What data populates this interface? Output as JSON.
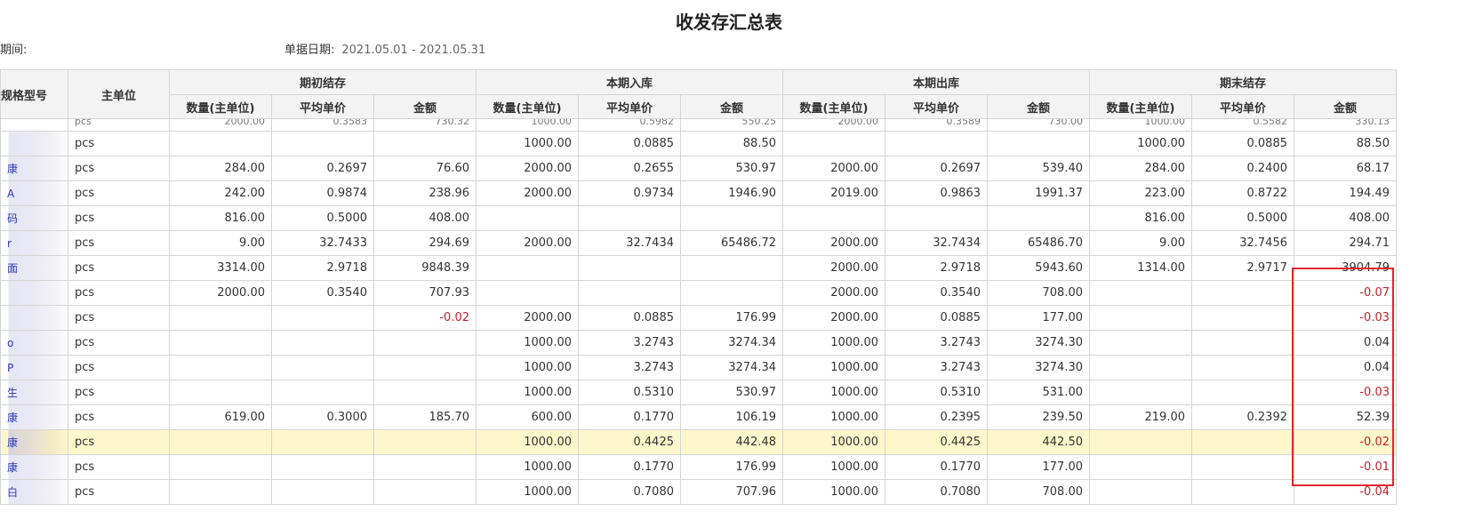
{
  "title": "收发存汇总表",
  "meta": {
    "period_label": "期间:",
    "date_label": "单据日期:",
    "date_value": "2021.05.01 - 2021.05.31"
  },
  "headers": {
    "spec": "规格型号",
    "unit": "主单位",
    "groups": [
      "期初结存",
      "本期入库",
      "本期出库",
      "期末结存"
    ],
    "sub": [
      "数量(主单位)",
      "平均单价",
      "金额"
    ]
  },
  "top_cut_row": [
    "",
    "",
    "pcs",
    "2000.00",
    "0.3583",
    "730.32",
    "1000.00",
    "0.5982",
    "550.25",
    "2000.00",
    "0.3589",
    "730.00",
    "1000.00",
    "0.5582",
    "330.13"
  ],
  "rows": [
    {
      "spec": "",
      "unit": "pcs",
      "v": [
        "",
        "",
        "",
        "1000.00",
        "0.0885",
        "88.50",
        "",
        "",
        "",
        "1000.00",
        "0.0885",
        "88.50"
      ]
    },
    {
      "spec": "康",
      "unit": "pcs",
      "v": [
        "284.00",
        "0.2697",
        "76.60",
        "2000.00",
        "0.2655",
        "530.97",
        "2000.00",
        "0.2697",
        "539.40",
        "284.00",
        "0.2400",
        "68.17"
      ]
    },
    {
      "spec": "A",
      "unit": "pcs",
      "v": [
        "242.00",
        "0.9874",
        "238.96",
        "2000.00",
        "0.9734",
        "1946.90",
        "2019.00",
        "0.9863",
        "1991.37",
        "223.00",
        "0.8722",
        "194.49"
      ]
    },
    {
      "spec": "码",
      "unit": "pcs",
      "v": [
        "816.00",
        "0.5000",
        "408.00",
        "",
        "",
        "",
        "",
        "",
        "",
        "816.00",
        "0.5000",
        "408.00"
      ]
    },
    {
      "spec": "r",
      "unit": "pcs",
      "v": [
        "9.00",
        "32.7433",
        "294.69",
        "2000.00",
        "32.7434",
        "65486.72",
        "2000.00",
        "32.7434",
        "65486.70",
        "9.00",
        "32.7456",
        "294.71"
      ]
    },
    {
      "spec": "面",
      "unit": "pcs",
      "v": [
        "3314.00",
        "2.9718",
        "9848.39",
        "",
        "",
        "",
        "2000.00",
        "2.9718",
        "5943.60",
        "1314.00",
        "2.9717",
        "3904.79"
      ]
    },
    {
      "spec": "",
      "unit": "pcs",
      "v": [
        "2000.00",
        "0.3540",
        "707.93",
        "",
        "",
        "",
        "2000.00",
        "0.3540",
        "708.00",
        "",
        "",
        "-0.07"
      ]
    },
    {
      "spec": "",
      "unit": "pcs",
      "v": [
        "",
        "",
        "-0.02",
        "2000.00",
        "0.0885",
        "176.99",
        "2000.00",
        "0.0885",
        "177.00",
        "",
        "",
        "-0.03"
      ]
    },
    {
      "spec": "o",
      "unit": "pcs",
      "v": [
        "",
        "",
        "",
        "1000.00",
        "3.2743",
        "3274.34",
        "1000.00",
        "3.2743",
        "3274.30",
        "",
        "",
        "0.04"
      ]
    },
    {
      "spec": "P",
      "unit": "pcs",
      "v": [
        "",
        "",
        "",
        "1000.00",
        "3.2743",
        "3274.34",
        "1000.00",
        "3.2743",
        "3274.30",
        "",
        "",
        "0.04"
      ]
    },
    {
      "spec": "生",
      "unit": "pcs",
      "v": [
        "",
        "",
        "",
        "1000.00",
        "0.5310",
        "530.97",
        "1000.00",
        "0.5310",
        "531.00",
        "",
        "",
        "-0.03"
      ]
    },
    {
      "spec": "康",
      "unit": "pcs",
      "v": [
        "619.00",
        "0.3000",
        "185.70",
        "600.00",
        "0.1770",
        "106.19",
        "1000.00",
        "0.2395",
        "239.50",
        "219.00",
        "0.2392",
        "52.39"
      ]
    },
    {
      "spec": "康",
      "unit": "pcs",
      "highlight": true,
      "v": [
        "",
        "",
        "",
        "1000.00",
        "0.4425",
        "442.48",
        "1000.00",
        "0.4425",
        "442.50",
        "",
        "",
        "-0.02"
      ]
    },
    {
      "spec": "康",
      "unit": "pcs",
      "v": [
        "",
        "",
        "",
        "1000.00",
        "0.1770",
        "176.99",
        "1000.00",
        "0.1770",
        "177.00",
        "",
        "",
        "-0.01"
      ]
    },
    {
      "spec": "白",
      "unit": "pcs",
      "v": [
        "",
        "",
        "",
        "1000.00",
        "0.7080",
        "707.96",
        "1000.00",
        "0.7080",
        "708.00",
        "",
        "",
        "-0.04"
      ]
    }
  ],
  "colors": {
    "negative": "#c0232c",
    "highlight_row": "#fdf7cc",
    "annotation_box": "#e0262d",
    "header_bg": "#f3f3f3"
  }
}
